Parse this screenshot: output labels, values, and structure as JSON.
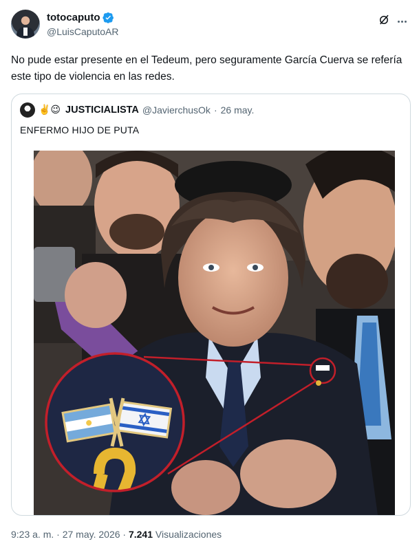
{
  "post": {
    "display_name": "totocaputo",
    "handle": "@LuisCaputoAR",
    "text": "No pude estar presente en el Tedeum, pero seguramente García Cuerva se refería este tipo de violencia en las redes.",
    "verified_color": "#1d9bf0"
  },
  "quoted": {
    "emojis": "✌️😉",
    "display_name": "JUSTICIALISTA",
    "handle": "@JavierchusOk",
    "separator": "·",
    "date": "26 may.",
    "text": "ENFERMO HIJO DE PUTA"
  },
  "footer": {
    "time": "9:23 a. m.",
    "separator": "·",
    "date": "27 may. 2026",
    "views_count": "7.241",
    "views_label": "Visualizaciones"
  },
  "icons": {
    "verified": "verified-badge-icon",
    "grok": "grok-icon",
    "more": "more-options-icon"
  }
}
